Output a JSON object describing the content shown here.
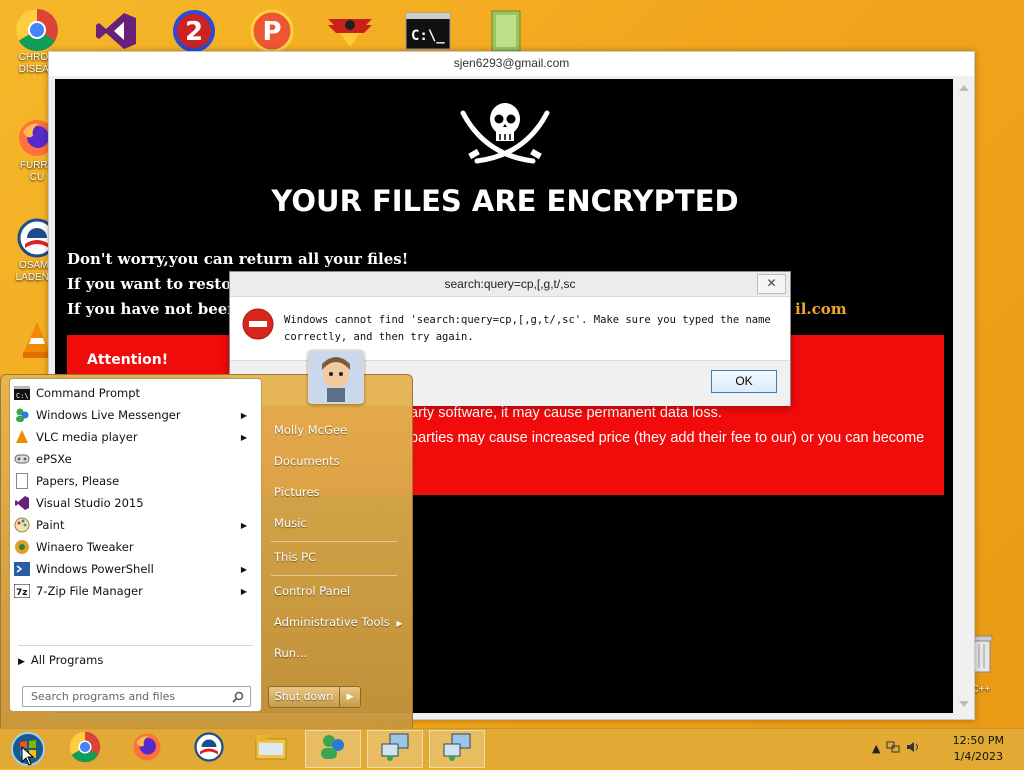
{
  "desktop": {
    "icons": [
      {
        "label": "CHRON DISEAS",
        "icon": "chrome-icon"
      },
      {
        "label": "FURRY CU",
        "icon": "firefox-icon"
      },
      {
        "label": "OSAMA LADEN B",
        "icon": "obama-logo-icon"
      },
      {
        "label": "",
        "icon": "vlc-icon"
      }
    ],
    "top_icons": [
      "visual-studio-icon",
      "game-2-icon",
      "game-p-icon",
      "emblem-icon",
      "cmd-icon",
      "folder-icon"
    ],
    "recycle_label": "n C++"
  },
  "ransom_window": {
    "title": "sjen6293@gmail.com",
    "heading": "YOUR FILES ARE ENCRYPTED",
    "line1": "Don't worry,you can return all your files!",
    "line2": "If you want to restore",
    "line3": "If you have not been a",
    "email_fragment": "il.com",
    "attention_title": "Attention!",
    "attention_line1": "arty software, it may cause permanent data loss.",
    "attention_line2": "parties may cause increased price (they add their fee to our) or you can become"
  },
  "error_dialog": {
    "title": "search:query=cp,[,g,t/,sc",
    "close": "✕",
    "message": "Windows cannot find 'search:query=cp,[,g,t/,sc'. Make sure you typed the name correctly, and then try again.",
    "ok_label": "OK"
  },
  "start_menu": {
    "programs": [
      {
        "label": "Command Prompt",
        "icon": "cmd-icon",
        "has_submenu": false
      },
      {
        "label": "Windows Live Messenger",
        "icon": "messenger-icon",
        "has_submenu": true
      },
      {
        "label": "VLC media player",
        "icon": "vlc-icon",
        "has_submenu": true
      },
      {
        "label": "ePSXe",
        "icon": "gamepad-icon",
        "has_submenu": false
      },
      {
        "label": "Papers, Please",
        "icon": "document-icon",
        "has_submenu": false
      },
      {
        "label": "Visual Studio 2015",
        "icon": "visual-studio-icon",
        "has_submenu": false
      },
      {
        "label": "Paint",
        "icon": "paint-icon",
        "has_submenu": true
      },
      {
        "label": "Winaero Tweaker",
        "icon": "tweaker-icon",
        "has_submenu": false
      },
      {
        "label": "Windows PowerShell",
        "icon": "powershell-icon",
        "has_submenu": true
      },
      {
        "label": "7-Zip File Manager",
        "icon": "7zip-icon",
        "has_submenu": true
      }
    ],
    "all_programs": "All Programs",
    "search_placeholder": "Search programs and files",
    "right_items": {
      "user": "Molly McGee",
      "documents": "Documents",
      "pictures": "Pictures",
      "music": "Music",
      "this_pc": "This PC",
      "control_panel": "Control Panel",
      "admin_tools": "Administrative Tools",
      "run": "Run..."
    },
    "shutdown": "Shut down",
    "submenu_arrow": "▶"
  },
  "taskbar": {
    "time": "12:50 PM",
    "date": "1/4/2023"
  }
}
